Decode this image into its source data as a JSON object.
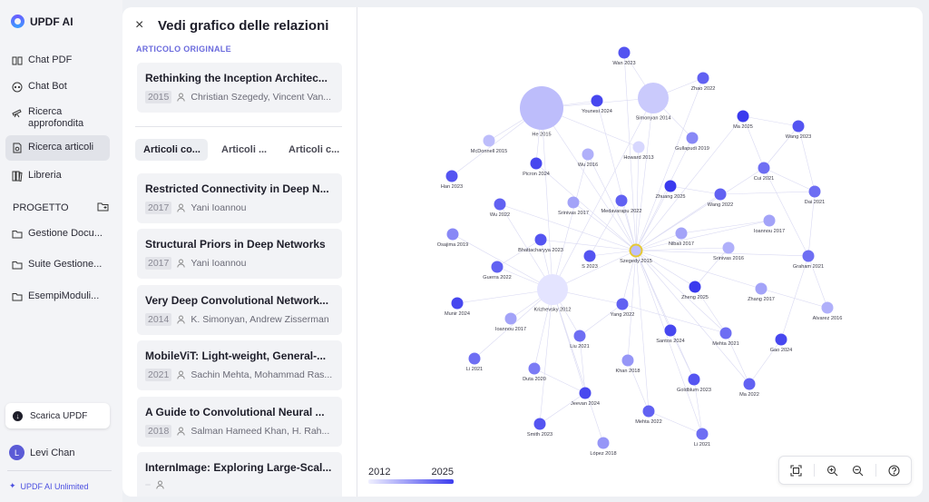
{
  "brand": {
    "name": "UPDF AI"
  },
  "nav": {
    "items": [
      {
        "label": "Chat PDF",
        "icon": "book-icon"
      },
      {
        "label": "Chat Bot",
        "icon": "chat-icon"
      },
      {
        "label": "Ricerca approfondita",
        "icon": "telescope-icon"
      },
      {
        "label": "Ricerca articoli",
        "icon": "paper-search-icon",
        "active": true
      },
      {
        "label": "Libreria",
        "icon": "library-icon"
      }
    ],
    "project_label": "PROGETTO",
    "projects": [
      {
        "label": "Gestione Docu..."
      },
      {
        "label": "Suite Gestione..."
      },
      {
        "label": "EsempiModuli..."
      }
    ],
    "download_label": "Scarica UPDF",
    "user": {
      "initial": "L",
      "name": "Levi Chan"
    },
    "plan_label": "UPDF AI Unlimited"
  },
  "panel": {
    "title": "Vedi grafico delle relazioni",
    "original_label": "ARTICOLO ORIGINALE",
    "original": {
      "title": "Rethinking the Inception Architec...",
      "year": "2015",
      "authors": "Christian Szegedy, Vincent Van..."
    },
    "tabs": [
      "Articoli co...",
      "Articoli ...",
      "Articoli c..."
    ],
    "papers": [
      {
        "title": "Restricted Connectivity in Deep N...",
        "year": "2017",
        "authors": "Yani Ioannou"
      },
      {
        "title": "Structural Priors in Deep Networks",
        "year": "2017",
        "authors": "Yani Ioannou"
      },
      {
        "title": "Very Deep Convolutional Network...",
        "year": "2014",
        "authors": "K. Simonyan, Andrew Zisserman"
      },
      {
        "title": "MobileViT: Light-weight, General-...",
        "year": "2021",
        "authors": "Sachin Mehta, Mohammad Ras..."
      },
      {
        "title": "A Guide to Convolutional Neural ...",
        "year": "2018",
        "authors": "Salman Hameed Khan, H. Rah..."
      },
      {
        "title": "InternImage: Exploring Large-Scal...",
        "year": "",
        "authors": ""
      }
    ]
  },
  "graph": {
    "legend": {
      "min": "2012",
      "max": "2025"
    },
    "nodes": [
      {
        "label": "Wan 2023",
        "year": 2023,
        "size": "s"
      },
      {
        "label": "Zhao 2022",
        "year": 2022,
        "size": "s"
      },
      {
        "label": "He 2015",
        "year": 2015,
        "size": "xl"
      },
      {
        "label": "Younesi 2024",
        "year": 2024,
        "size": "s"
      },
      {
        "label": "Simonyan 2014",
        "year": 2014,
        "size": "l"
      },
      {
        "label": "Ma 2025",
        "year": 2025,
        "size": "s"
      },
      {
        "label": "Wang 2023",
        "year": 2023,
        "size": "s"
      },
      {
        "label": "McDonnell 2015",
        "year": 2015,
        "size": "s"
      },
      {
        "label": "Gullapudi 2019",
        "year": 2019,
        "size": "s"
      },
      {
        "label": "Howard 2013",
        "year": 2013,
        "size": "s"
      },
      {
        "label": "Picron 2024",
        "year": 2024,
        "size": "s"
      },
      {
        "label": "Wu 2016",
        "year": 2016,
        "size": "s"
      },
      {
        "label": "Cui 2021",
        "year": 2021,
        "size": "s"
      },
      {
        "label": "Han 2023",
        "year": 2023,
        "size": "s"
      },
      {
        "label": "Zhuang 2025",
        "year": 2025,
        "size": "s"
      },
      {
        "label": "Dai 2021",
        "year": 2021,
        "size": "s"
      },
      {
        "label": "Wu 2022",
        "year": 2022,
        "size": "s"
      },
      {
        "label": "Srinivas 2017",
        "year": 2017,
        "size": "s"
      },
      {
        "label": "Medavarapu 2022",
        "year": 2022,
        "size": "s"
      },
      {
        "label": "Wang 2022",
        "year": 2022,
        "size": "s"
      },
      {
        "label": "Ioannou 2017",
        "year": 2017,
        "size": "s"
      },
      {
        "label": "Osajima 2019",
        "year": 2019,
        "size": "s"
      },
      {
        "label": "Bhattacharyya 2023",
        "year": 2023,
        "size": "s"
      },
      {
        "label": "Nibali 2017",
        "year": 2017,
        "size": "s"
      },
      {
        "label": "Srinivas 2016",
        "year": 2016,
        "size": "s"
      },
      {
        "label": "S 2023",
        "year": 2023,
        "size": "s"
      },
      {
        "label": "Szegedy 2015",
        "year": 2015,
        "size": "s",
        "selected": true
      },
      {
        "label": "Graham 2021",
        "year": 2021,
        "size": "s"
      },
      {
        "label": "Guerra 2022",
        "year": 2022,
        "size": "s"
      },
      {
        "label": "Zheng 2025",
        "year": 2025,
        "size": "s"
      },
      {
        "label": "Zhang 2017",
        "year": 2017,
        "size": "s"
      },
      {
        "label": "Krizhevsky 2012",
        "year": 2012,
        "size": "l"
      },
      {
        "label": "Munir 2024",
        "year": 2024,
        "size": "s"
      },
      {
        "label": "Yang 2022",
        "year": 2022,
        "size": "s"
      },
      {
        "label": "Alvarez 2016",
        "year": 2016,
        "size": "s"
      },
      {
        "label": "Ioannou 2017",
        "year": 2017,
        "size": "s"
      },
      {
        "label": "Santos 2024",
        "year": 2024,
        "size": "s"
      },
      {
        "label": "Mehta 2021",
        "year": 2021,
        "size": "s"
      },
      {
        "label": "Gao 2024",
        "year": 2024,
        "size": "s"
      },
      {
        "label": "Liu 2021",
        "year": 2021,
        "size": "s"
      },
      {
        "label": "Li 2021",
        "year": 2021,
        "size": "s"
      },
      {
        "label": "Khan 2018",
        "year": 2018,
        "size": "s"
      },
      {
        "label": "Duta 2020",
        "year": 2020,
        "size": "s"
      },
      {
        "label": "Goldblum 2023",
        "year": 2023,
        "size": "s"
      },
      {
        "label": "Ma 2022",
        "year": 2022,
        "size": "s"
      },
      {
        "label": "Jeevan 2024",
        "year": 2024,
        "size": "s"
      },
      {
        "label": "Mehta 2022",
        "year": 2022,
        "size": "s"
      },
      {
        "label": "Smith 2023",
        "year": 2023,
        "size": "s"
      },
      {
        "label": "Li 2021",
        "year": 2021,
        "size": "s"
      },
      {
        "label": "López 2018",
        "year": 2018,
        "size": "s"
      }
    ],
    "toolbar": [
      "fit-screen-icon",
      "zoom-in-icon",
      "zoom-out-icon",
      "help-icon"
    ]
  }
}
